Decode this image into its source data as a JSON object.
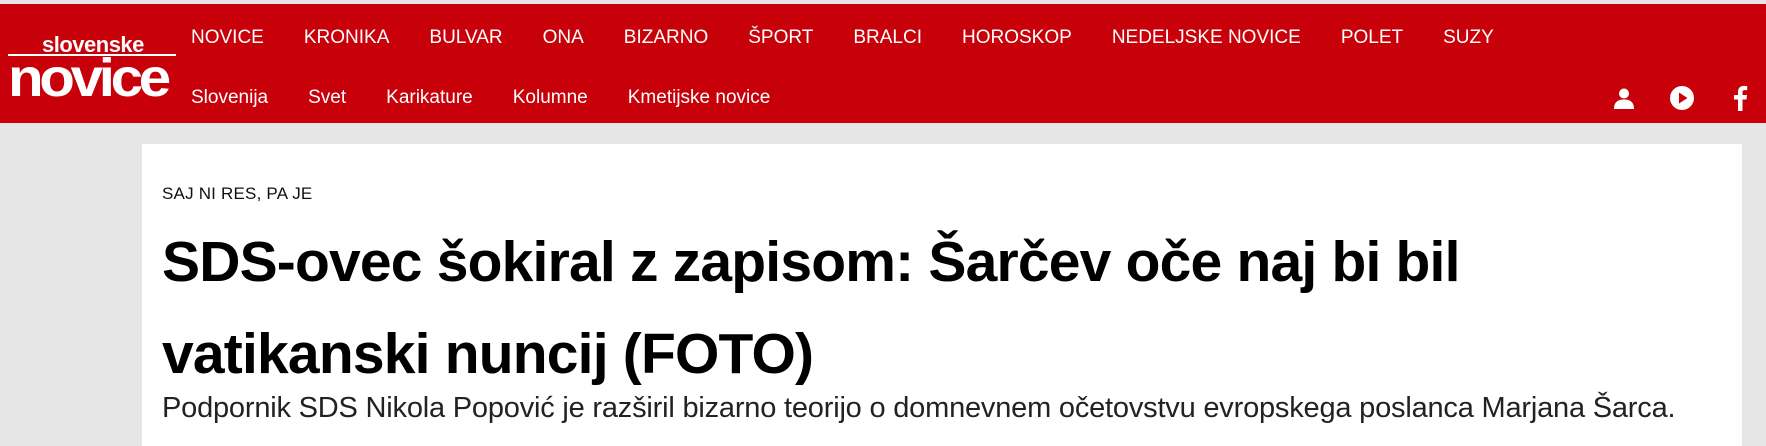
{
  "site": {
    "logo_top": "slovenske",
    "logo_main": "novice",
    "brand_color": "#c8000a"
  },
  "nav": {
    "primary": [
      "NOVICE",
      "KRONIKA",
      "BULVAR",
      "ONA",
      "BIZARNO",
      "ŠPORT",
      "BRALCI",
      "HOROSKOP",
      "NEDELJSKE NOVICE",
      "POLET",
      "SUZY"
    ],
    "secondary": [
      "Slovenija",
      "Svet",
      "Karikature",
      "Kolumne",
      "Kmetijske novice"
    ]
  },
  "header_icons": [
    "user-icon",
    "play-icon",
    "facebook-icon"
  ],
  "article": {
    "kicker": "SAJ NI RES, PA JE",
    "title": "SDS-ovec šokiral z zapisom: Šarčev oče naj bi bil vatikanski nuncij (FOTO)",
    "lead": "Podpornik SDS Nikola Popović je razširil bizarno teorijo o domnevnem očetovstvu evropskega poslanca Marjana Šarca."
  }
}
